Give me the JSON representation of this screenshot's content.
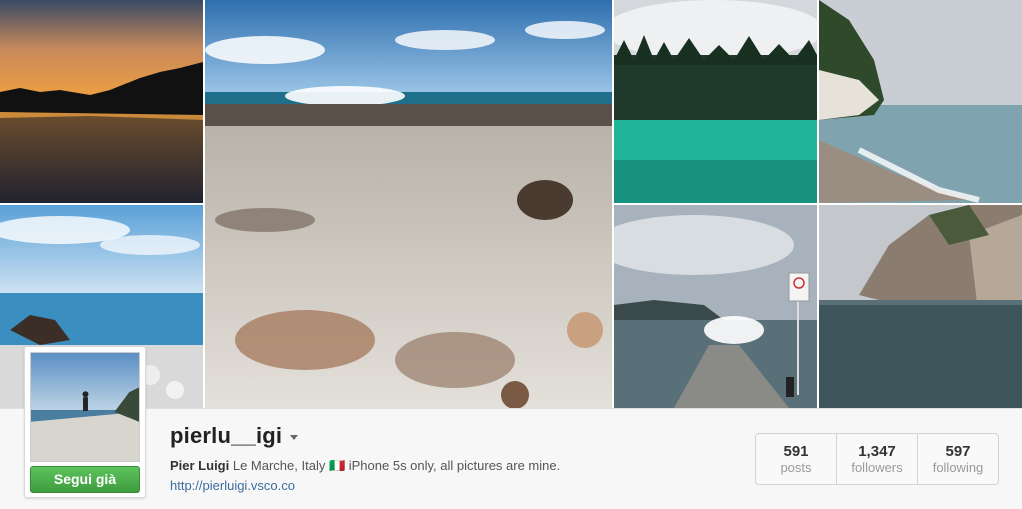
{
  "profile": {
    "username": "pierlu__igi",
    "full_name": "Pier Luigi",
    "bio": " Le Marche, Italy 🇮🇹 iPhone 5s only, all pictures are mine.",
    "website": "http://pierluigi.vsco.co",
    "follow_button": "Segui già"
  },
  "stats": [
    {
      "value": "591",
      "label": "posts"
    },
    {
      "value": "1,347",
      "label": "followers"
    },
    {
      "value": "597",
      "label": "following"
    }
  ],
  "colors": {
    "follow_green": "#4cae4c",
    "link_blue": "#3b6e9e"
  },
  "icons": {
    "username_menu": "caret-down-icon"
  }
}
